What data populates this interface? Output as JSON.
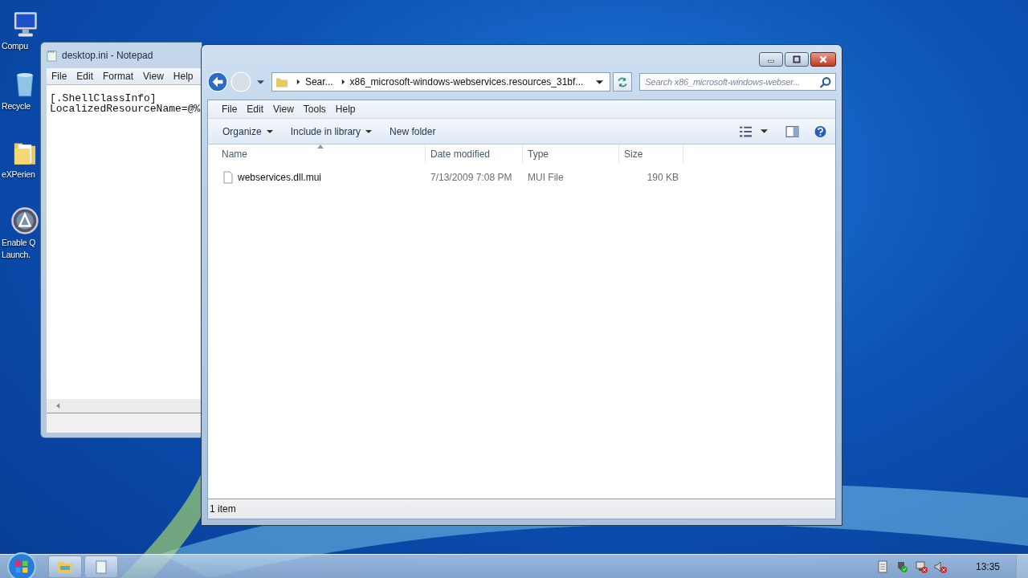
{
  "desktop_icons": [
    {
      "kind": "computer",
      "lines": [
        "Compu"
      ]
    },
    {
      "kind": "recycle",
      "lines": [
        "Recycle"
      ]
    },
    {
      "kind": "folder",
      "lines": [
        "eXPerien"
      ]
    },
    {
      "kind": "launch",
      "lines": [
        "Enable Q",
        "Launch."
      ]
    }
  ],
  "notepad": {
    "title": "desktop.ini - Notepad",
    "menu": [
      "File",
      "Edit",
      "Format",
      "View",
      "Help"
    ],
    "lines": [
      "[.ShellClassInfo]",
      "LocalizedResourceName=@%"
    ]
  },
  "explorer": {
    "breadcrumbs": [
      "Sear...",
      "x86_microsoft-windows-webservices.resources_31bf..."
    ],
    "search": {
      "placeholder": "Search x86_microsoft-windows-webser..."
    },
    "menu": [
      "File",
      "Edit",
      "View",
      "Tools",
      "Help"
    ],
    "toolbar": [
      {
        "label": "Organize",
        "dropdown": true
      },
      {
        "label": "Include in library",
        "dropdown": true
      },
      {
        "label": "New folder",
        "dropdown": false
      }
    ],
    "columns": [
      {
        "label": "Name",
        "sorted": true
      },
      {
        "label": "Date modified",
        "sorted": false
      },
      {
        "label": "Type",
        "sorted": false
      },
      {
        "label": "Size",
        "sorted": false
      }
    ],
    "rows": [
      {
        "name": "webservices.dll.mui",
        "date_modified": "7/13/2009 7:08 PM",
        "type": "MUI File",
        "size": "190 KB",
        "selected": false
      }
    ],
    "status_bar": "1 item"
  },
  "taskbar": {
    "buttons": [
      {
        "kind": "explorer"
      },
      {
        "kind": "notepad"
      }
    ],
    "tray_icons": [
      {
        "kind": "document"
      },
      {
        "kind": "security"
      },
      {
        "kind": "network"
      },
      {
        "kind": "volume"
      }
    ],
    "clock": "13:35"
  }
}
